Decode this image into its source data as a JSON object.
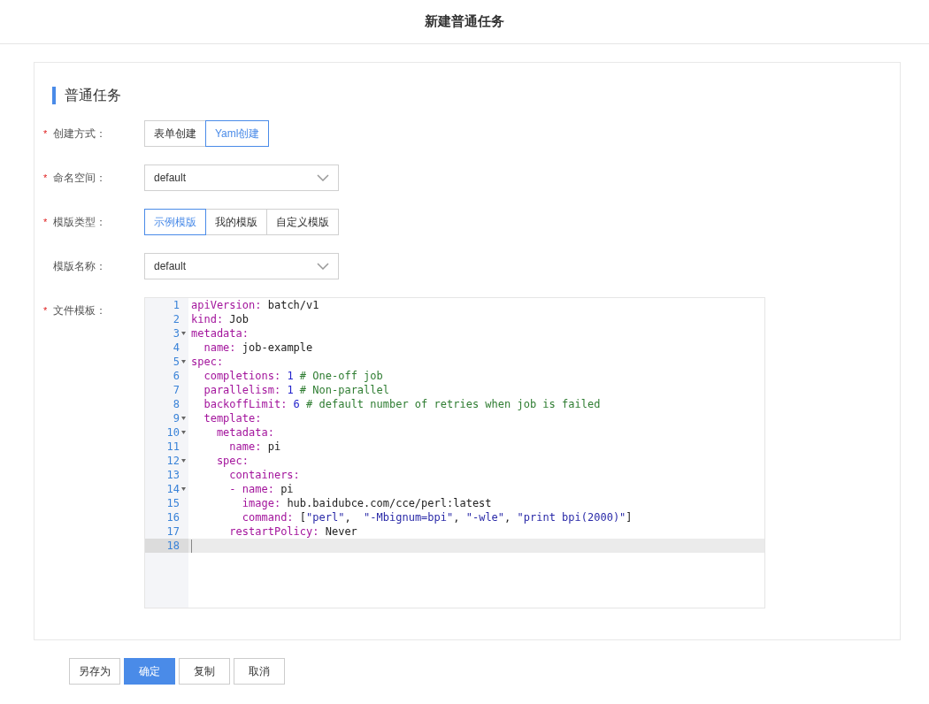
{
  "window": {
    "title": "新建普通任务"
  },
  "section": {
    "title": "普通任务"
  },
  "form": [
    {
      "kind": "segmented",
      "label": "创建方式：",
      "required_mark": "*",
      "options": [
        {
          "label": "表单创建",
          "selected": false
        },
        {
          "label": "Yaml创建",
          "selected": true
        }
      ]
    },
    {
      "kind": "select",
      "label": "命名空间：",
      "required_mark": "*",
      "value": "default"
    },
    {
      "kind": "segmented",
      "label": "模版类型：",
      "required_mark": "*",
      "options": [
        {
          "label": "示例模版",
          "selected": true
        },
        {
          "label": "我的模版",
          "selected": false
        },
        {
          "label": "自定义模版",
          "selected": false
        }
      ]
    },
    {
      "kind": "select",
      "label": "模版名称：",
      "value": "default"
    },
    {
      "kind": "editor",
      "label": "文件模板：",
      "required_mark": "*",
      "lines": [
        {
          "number": "1",
          "foldable": false,
          "active": false,
          "tokens": [
            {
              "kind": "key",
              "text": "apiVersion:"
            },
            {
              "kind": "plain",
              "text": " batch/v1"
            }
          ]
        },
        {
          "number": "2",
          "foldable": false,
          "active": false,
          "tokens": [
            {
              "kind": "key",
              "text": "kind:"
            },
            {
              "kind": "plain",
              "text": " Job"
            }
          ]
        },
        {
          "number": "3",
          "foldable": true,
          "active": false,
          "tokens": [
            {
              "kind": "key",
              "text": "metadata:"
            }
          ]
        },
        {
          "number": "4",
          "foldable": false,
          "active": false,
          "tokens": [
            {
              "kind": "key",
              "text": "  name:"
            },
            {
              "kind": "plain",
              "text": " job-example"
            }
          ]
        },
        {
          "number": "5",
          "foldable": true,
          "active": false,
          "tokens": [
            {
              "kind": "key",
              "text": "spec:"
            }
          ]
        },
        {
          "number": "6",
          "foldable": false,
          "active": false,
          "tokens": [
            {
              "kind": "key",
              "text": "  completions:"
            },
            {
              "kind": "num",
              "text": " 1"
            },
            {
              "kind": "comment",
              "text": " # One-off job"
            }
          ]
        },
        {
          "number": "7",
          "foldable": false,
          "active": false,
          "tokens": [
            {
              "kind": "key",
              "text": "  parallelism:"
            },
            {
              "kind": "num",
              "text": " 1"
            },
            {
              "kind": "comment",
              "text": " # Non-parallel"
            }
          ]
        },
        {
          "number": "8",
          "foldable": false,
          "active": false,
          "tokens": [
            {
              "kind": "key",
              "text": "  backoffLimit:"
            },
            {
              "kind": "num",
              "text": " 6"
            },
            {
              "kind": "comment",
              "text": " # default number of retries when job is failed"
            }
          ]
        },
        {
          "number": "9",
          "foldable": true,
          "active": false,
          "tokens": [
            {
              "kind": "key",
              "text": "  template:"
            }
          ]
        },
        {
          "number": "10",
          "foldable": true,
          "active": false,
          "tokens": [
            {
              "kind": "key",
              "text": "    metadata:"
            }
          ]
        },
        {
          "number": "11",
          "foldable": false,
          "active": false,
          "tokens": [
            {
              "kind": "key",
              "text": "      name:"
            },
            {
              "kind": "plain",
              "text": " pi"
            }
          ]
        },
        {
          "number": "12",
          "foldable": true,
          "active": false,
          "tokens": [
            {
              "kind": "key",
              "text": "    spec:"
            }
          ]
        },
        {
          "number": "13",
          "foldable": false,
          "active": false,
          "tokens": [
            {
              "kind": "key",
              "text": "      containers:"
            }
          ]
        },
        {
          "number": "14",
          "foldable": true,
          "active": false,
          "tokens": [
            {
              "kind": "key",
              "text": "      - name:"
            },
            {
              "kind": "plain",
              "text": " pi"
            }
          ]
        },
        {
          "number": "15",
          "foldable": false,
          "active": false,
          "tokens": [
            {
              "kind": "key",
              "text": "        image:"
            },
            {
              "kind": "plain",
              "text": " hub.baidubce.com/cce/perl:latest"
            }
          ]
        },
        {
          "number": "16",
          "foldable": false,
          "active": false,
          "tokens": [
            {
              "kind": "key",
              "text": "        command:"
            },
            {
              "kind": "plain",
              "text": " ["
            },
            {
              "kind": "str",
              "text": "\"perl\""
            },
            {
              "kind": "plain",
              "text": ",  "
            },
            {
              "kind": "str",
              "text": "\"-Mbignum=bpi\""
            },
            {
              "kind": "plain",
              "text": ", "
            },
            {
              "kind": "str",
              "text": "\"-wle\""
            },
            {
              "kind": "plain",
              "text": ", "
            },
            {
              "kind": "str",
              "text": "\"print bpi(2000)\""
            },
            {
              "kind": "plain",
              "text": "]"
            }
          ]
        },
        {
          "number": "17",
          "foldable": false,
          "active": false,
          "tokens": [
            {
              "kind": "key",
              "text": "      restartPolicy:"
            },
            {
              "kind": "plain",
              "text": " Never"
            }
          ]
        },
        {
          "number": "18",
          "foldable": false,
          "active": true
        }
      ]
    }
  ],
  "buttons": [
    {
      "label": "另存为",
      "primary": false
    },
    {
      "label": "确定",
      "primary": true
    },
    {
      "label": "复制",
      "primary": false
    },
    {
      "label": "取消",
      "primary": false
    }
  ]
}
